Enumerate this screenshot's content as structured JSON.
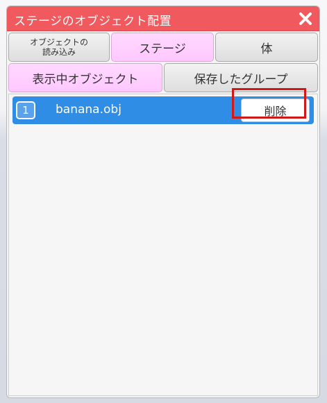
{
  "window": {
    "title": "ステージのオブジェクト配置",
    "close_icon": "close-icon"
  },
  "tabs_row1": {
    "load": {
      "line1": "オブジェクトの",
      "line2": "読み込み"
    },
    "stage": "ステージ",
    "body": "体"
  },
  "tabs_row2": {
    "shown": "表示中オブジェクト",
    "saved": "保存したグループ"
  },
  "list": {
    "items": [
      {
        "index": "1",
        "name": "banana.obj",
        "delete_label": "削除"
      }
    ]
  },
  "colors": {
    "title_bar": "#f05a5f",
    "active_tab": "#ffc8ff",
    "selected_row": "#2f8de6",
    "highlight": "#d01818"
  }
}
